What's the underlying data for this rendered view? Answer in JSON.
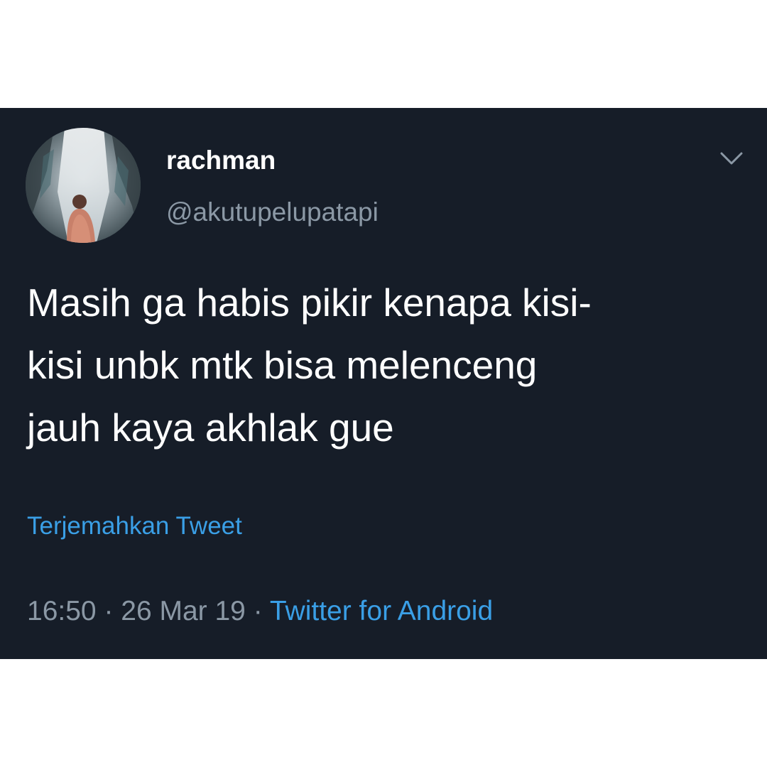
{
  "tweet": {
    "display_name": "rachman",
    "username": "@akutupelupatapi",
    "text_lines": [
      "Masih ga habis pikir kenapa kisi-",
      "kisi unbk mtk bisa melenceng",
      "jauh kaya akhlak gue"
    ],
    "translate_label": "Terjemahkan Tweet",
    "time": "16:50",
    "separator": " · ",
    "date": "26 Mar 19",
    "source": "Twitter for Android"
  },
  "icons": {
    "caret": "chevron-down-icon",
    "avatar": "avatar"
  },
  "colors": {
    "background": "#161d28",
    "text_primary": "#ffffff",
    "text_secondary": "#8b98a5",
    "link": "#3a9fe6"
  }
}
